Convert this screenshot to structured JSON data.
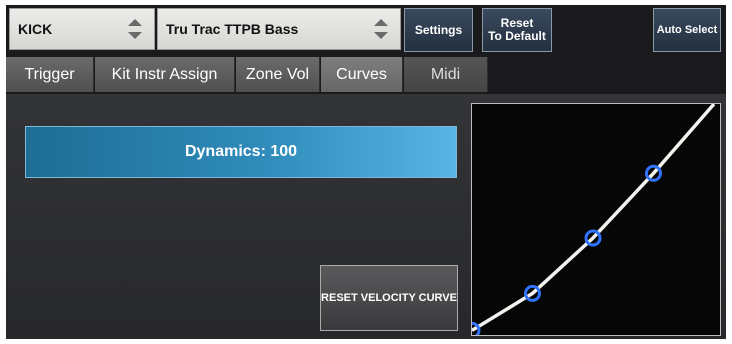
{
  "top": {
    "pad_select": "KICK",
    "instrument_select": "Tru Trac TTPB Bass",
    "settings_label": "Settings",
    "reset_line1": "Reset",
    "reset_line2": "To Default",
    "auto_select_label": "Auto Select"
  },
  "tabs": [
    {
      "label": "Trigger"
    },
    {
      "label": "Kit Instr Assign"
    },
    {
      "label": "Zone Vol"
    },
    {
      "label": "Curves"
    },
    {
      "label": "Midi"
    }
  ],
  "active_tab": "Curves",
  "curves": {
    "dynamics_label": "Dynamics: 100",
    "reset_velocity_label": "RESET VELOCITY CURVE",
    "points": [
      [
        0,
        0.02
      ],
      [
        0.25,
        0.18
      ],
      [
        0.5,
        0.42
      ],
      [
        0.75,
        0.7
      ]
    ]
  },
  "colors": {
    "accent": "#2f8cba",
    "curve": "#f2f2ee",
    "point": "#2f74ff"
  }
}
